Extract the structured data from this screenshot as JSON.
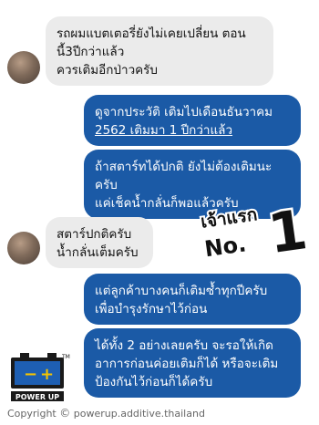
{
  "messages": [
    {
      "side": "in",
      "lines": [
        "รถผมแบตเตอรี่ยังไม่เคยเปลี่ยน ตอน",
        "นี้3ปีกว่าแล้ว",
        "ควรเติมอีกป่าวครับ"
      ]
    },
    {
      "side": "out",
      "lines": [
        "ดูจากประวัติ เติมไปเดือนธันวาคม",
        "2562 เติมมา 1 ปีกว่าแล้ว"
      ]
    },
    {
      "side": "out",
      "lines": [
        "ถ้าสตาร์ทได้ปกติ ยังไม่ต้องเติมนะ",
        "ครับ",
        "แค่เช็คน้ำกลั่นก็พอแล้วครับ"
      ]
    },
    {
      "side": "in",
      "lines": [
        "สตาร์ปกติครับ",
        "น้ำกลั่นเต็มครับ"
      ]
    },
    {
      "side": "out",
      "lines": [
        "แต่ลูกค้าบางคนก็เติมซ้ำทุกปีครับ",
        "เพื่อบำรุงรักษาไว้ก่อน"
      ]
    },
    {
      "side": "out",
      "lines": [
        "ได้ทั้ง 2 อย่างเลยครับ จะรอให้เกิด",
        "อาการก่อนค่อยเติมก็ได้ หรือจะเติม",
        "ป้องกันไว้ก่อนก็ได้ครับ"
      ]
    }
  ],
  "badge": {
    "line1": "เจ้าแรก",
    "line2": "No.",
    "number": "1"
  },
  "logo": {
    "minus": "−",
    "plus": "+",
    "tm": "TM",
    "text": "POWER UP"
  },
  "copyright": {
    "label": "Copyright",
    "symbol": "©",
    "site": "powerup.additive.thailand"
  },
  "colors": {
    "outgoing": "#1b5aa6",
    "incoming": "#ebebeb"
  }
}
